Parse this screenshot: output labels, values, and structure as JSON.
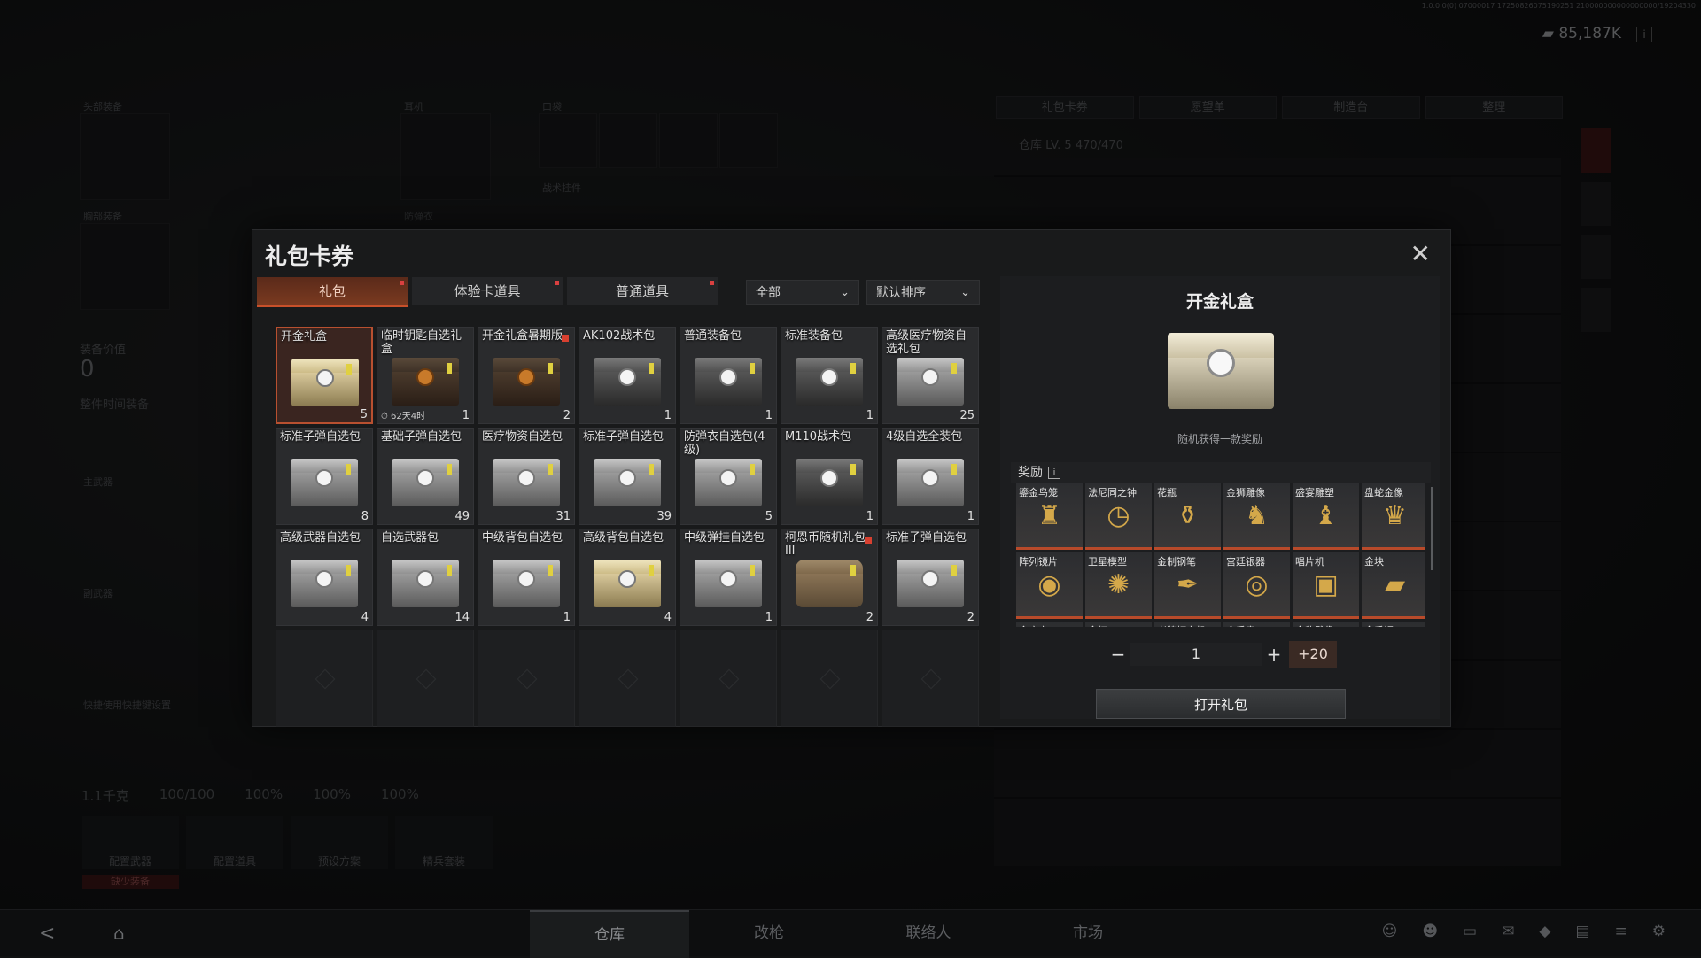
{
  "build_info": "1.0.0.0(0) 07000017 17250826075190251 210000000000000000/19204330",
  "currency": {
    "value": "85,187K",
    "icon": "coin-stack-icon"
  },
  "warehouse": {
    "tabs": [
      "礼包卡券",
      "愿望单",
      "制造台",
      "整理"
    ],
    "capacity": "仓库 LV. 5 470/470"
  },
  "loadout": {
    "labels": {
      "head": "头部装备",
      "ear": "耳机",
      "pocket": "口袋",
      "chest": "胸部装备",
      "armor": "防弹衣",
      "tactical": "战术挂件",
      "primary": "主武器",
      "secondary": "副武器",
      "consumable": "快捷使用快捷键设置"
    },
    "value_label": "装备价值",
    "value": "0",
    "hide_label": "整件时间装备"
  },
  "stats": [
    "1.1千克",
    "100/100",
    "100%",
    "100%",
    "100%"
  ],
  "actions": [
    "配置武器",
    "配置道具",
    "预设方案",
    "精兵套装"
  ],
  "warning": "缺少装备",
  "bottom_nav": {
    "tabs": [
      "仓库",
      "改枪",
      "联络人",
      "市场"
    ],
    "active": 0
  },
  "modal": {
    "title": "礼包卡券",
    "close_icon": "close-icon",
    "tabs": [
      {
        "label": "礼包",
        "active": true
      },
      {
        "label": "体验卡道具",
        "active": false
      },
      {
        "label": "普通道具",
        "active": false
      }
    ],
    "filter": {
      "selected": "全部"
    },
    "sort": {
      "selected": "默认排序"
    },
    "items": [
      {
        "name": "开金礼盒",
        "count": "5",
        "variant": "gold",
        "selected": true
      },
      {
        "name": "临时钥匙自选礼盒",
        "count": "1",
        "variant": "brown",
        "timer": "62天4时"
      },
      {
        "name": "开金礼盒暑期版",
        "count": "2",
        "variant": "brown",
        "mark": true
      },
      {
        "name": "AK102战术包",
        "count": "1",
        "variant": "dark"
      },
      {
        "name": "普通装备包",
        "count": "1",
        "variant": "dark"
      },
      {
        "name": "标准装备包",
        "count": "1",
        "variant": "dark"
      },
      {
        "name": "高级医疗物资自选礼包",
        "count": "25",
        "variant": "white"
      },
      {
        "name": "标准子弹自选包",
        "count": "8",
        "variant": "white"
      },
      {
        "name": "基础子弹自选包",
        "count": "49",
        "variant": "white"
      },
      {
        "name": "医疗物资自选包",
        "count": "31",
        "variant": "white"
      },
      {
        "name": "标准子弹自选包",
        "count": "39",
        "variant": "white"
      },
      {
        "name": "防弹衣自选包(4级)",
        "count": "5",
        "variant": "white"
      },
      {
        "name": "M110战术包",
        "count": "1",
        "variant": "dark"
      },
      {
        "name": "4级自选全装包",
        "count": "1",
        "variant": "white"
      },
      {
        "name": "高级武器自选包",
        "count": "4",
        "variant": "white"
      },
      {
        "name": "自选武器包",
        "count": "14",
        "variant": "white"
      },
      {
        "name": "中级背包自选包",
        "count": "1",
        "variant": "white"
      },
      {
        "name": "高级背包自选包",
        "count": "4",
        "variant": "gold"
      },
      {
        "name": "中级弹挂自选包",
        "count": "1",
        "variant": "white"
      },
      {
        "name": "柯恩币随机礼包III",
        "count": "2",
        "variant": "bag",
        "mark": true
      },
      {
        "name": "标准子弹自选包",
        "count": "2",
        "variant": "white"
      }
    ],
    "empty_slots": 7,
    "detail": {
      "title": "开金礼盒",
      "description": "随机获得一款奖励",
      "rewards_label": "奖励",
      "rewards": [
        {
          "name": "鎏金鸟笼",
          "icon": "birdcage-icon"
        },
        {
          "name": "法尼同之钟",
          "icon": "clock-icon"
        },
        {
          "name": "花瓶",
          "icon": "vase-icon"
        },
        {
          "name": "金狮雕像",
          "icon": "lion-statue-icon"
        },
        {
          "name": "盛宴雕塑",
          "icon": "bust-statue-icon"
        },
        {
          "name": "盘蛇金像",
          "icon": "snake-statue-icon"
        },
        {
          "name": "阵列镜片",
          "icon": "lens-icon"
        },
        {
          "name": "卫星模型",
          "icon": "satellite-icon"
        },
        {
          "name": "金制钢笔",
          "icon": "pen-icon"
        },
        {
          "name": "宫廷银器",
          "icon": "silver-plate-icon"
        },
        {
          "name": "唱片机",
          "icon": "record-player-icon"
        },
        {
          "name": "金块",
          "icon": "gold-bar-icon"
        },
        {
          "name": "金座方...",
          "icon": "item-icon"
        },
        {
          "name": "金杯",
          "icon": "item-icon"
        },
        {
          "name": "老牌打字机",
          "icon": "item-icon"
        },
        {
          "name": "金手表",
          "icon": "item-icon"
        },
        {
          "name": "金豹雕像",
          "icon": "item-icon"
        },
        {
          "name": "金手镯",
          "icon": "item-icon"
        }
      ],
      "quantity": "1",
      "quick_add": "+20",
      "open_label": "打开礼包"
    }
  }
}
